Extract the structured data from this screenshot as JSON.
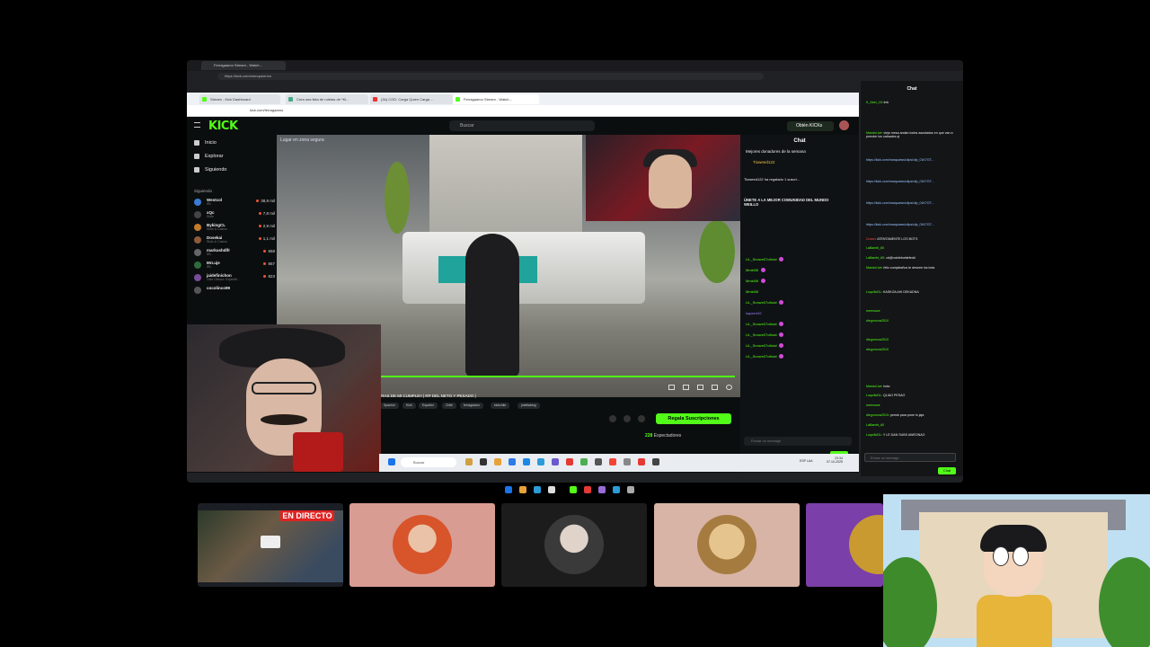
{
  "outer_browser": {
    "tab_title": "Ferragaamo Stream - Watch...",
    "url": "https://kick.com/mnnqueennn"
  },
  "inner_browser": {
    "tabs": [
      "Stream - Kick Dashboard",
      "Crea una lista de ruletas de *Ki...",
      "(34) COD: Carga Quien Carga ...",
      "Ferragaamo Stream - Watch..."
    ],
    "url": "kick.com/ferragaamo"
  },
  "kick": {
    "logo": "KICK",
    "search_placeholder": "Buscar",
    "get_kicks": "Obtén KICKs",
    "nav": [
      "Inicio",
      "Explorar",
      "Siguiendo"
    ],
    "following_header": "Siguiendo",
    "following": [
      {
        "name": "Westcol",
        "sub": "IRL",
        "viewers": "38,9 mil",
        "color": "#3a7bd5"
      },
      {
        "name": "xQc",
        "sub": "Slots",
        "viewers": "7,8 mil",
        "color": "#444444"
      },
      {
        "name": "BykingCL",
        "sub": "Slots & Casino",
        "viewers": "2,9 mil",
        "color": "#c47a2c"
      },
      {
        "name": "Dosekai",
        "sub": "Slots & Casino",
        "viewers": "1,1 mil",
        "color": "#8d5a3b"
      },
      {
        "name": "markushdlfr",
        "sub": "IRL",
        "viewers": "658",
        "color": "#666666"
      },
      {
        "name": "MrLuje",
        "sub": "IRL",
        "viewers": "857",
        "color": "#2f6b3a"
      },
      {
        "name": "jaidefinichon",
        "sub": "Clair Obscur: Expediti...",
        "viewers": "823",
        "color": "#7a4b9a"
      },
      {
        "name": "cocolinco99",
        "sub": "",
        "viewers": "",
        "color": "#555555"
      }
    ],
    "video_overlay": "Lugar en zona segura",
    "stream_title": "IRAS DE MI CUMPLE!! | RP DEL NETO Y PESADO |",
    "tags": [
      "Spanish",
      "Kick",
      "Español",
      "Chile",
      "ferragaamo",
      "kickchile",
      "joekitaking"
    ],
    "sub_button": "Regala Suscripciones",
    "viewers_count": "228",
    "viewers_label": "Espectadores",
    "chat_title": "Chat",
    "donors_title": "Mejores donadores de la semana",
    "donor": "Tioweed122",
    "gift_banner": "Tioweed122 ha regalado 1 suscri...",
    "pinned": "ÚNETE A LA MEJOR COMUNIDAD DEL MUNDO WEILLO",
    "chat_users": [
      "LiL_Snowe07oficial",
      "Mmkt06",
      "Mmkt06",
      "Mmkt06",
      "LiL_Snowe07oficial",
      "kapeen92",
      "LiL_Snowe07oficial",
      "LiL_Snowe07oficial",
      "LiL_Snowe07oficial",
      "LiL_Snowe07oficial"
    ],
    "chat_placeholder": "Enviar un mensaje",
    "chat_send": "Chat"
  },
  "taskbar": {
    "search": "Buscar",
    "lang": "ESP LAA",
    "time": "23:34",
    "date": "07-10-2025"
  },
  "side_chat": {
    "title": "Chat",
    "messages": [
      {
        "user": "K_Abel_18",
        "text": "lmk"
      },
      {
        "user": "Mandol.ive",
        "text": "viejo mesa andan todos asustados en que van a prender los cabaales qi"
      },
      {
        "user": "",
        "text": "https://kick.com/marquwws/clips/clip_01K7GT..."
      },
      {
        "user": "",
        "text": "https://kick.com/marquwws/clips/clip_01K7GT..."
      },
      {
        "user": "",
        "text": "https://kick.com/marquwws/clips/clip_01K7GT..."
      },
      {
        "user": "",
        "text": "https://kick.com/marquwws/clips/clip_01K7GT..."
      },
      {
        "user": "Dosari",
        "text": "ATENTAMENTE LOS BOTS"
      },
      {
        "user": "LaBambi_60",
        "text": ""
      },
      {
        "user": "LaBambi_60",
        "text": "cd@rushtrbotdefedd"
      },
      {
        "user": "Mandol.ive",
        "text": "feliz cumpleaños te deseee los bots"
      },
      {
        "user": "LoquilloDL",
        "text": "KASKOA AHI DEKADNA"
      },
      {
        "user": "meenowe",
        "text": ""
      },
      {
        "user": "diegomora2510",
        "text": ""
      },
      {
        "user": "diegomora2510",
        "text": ""
      },
      {
        "user": "diegomora2510",
        "text": ""
      },
      {
        "user": "Mandol.ive",
        "text": "bota"
      },
      {
        "user": "LoquilloDL",
        "text": "QLIAO PESAO"
      },
      {
        "user": "meenowe",
        "text": ""
      },
      {
        "user": "diegomora2510",
        "text": "pensb para pone lo jaja"
      },
      {
        "user": "LaBambi_60",
        "text": ""
      },
      {
        "user": "LoquilloDL",
        "text": "Y LE DAN SUBS AWEONAO"
      }
    ],
    "placeholder": "Enviar un mensaje",
    "send": "Chat"
  },
  "bottom": {
    "live_badge": "EN DIRECTO",
    "cards": [
      {
        "bg": "#d89c93",
        "avatar": "#c77b56"
      },
      {
        "bg": "#1c1c1c",
        "avatar": "#cfcfcf"
      },
      {
        "bg": "#d7b4a5",
        "avatar": "#c2914f"
      }
    ]
  }
}
